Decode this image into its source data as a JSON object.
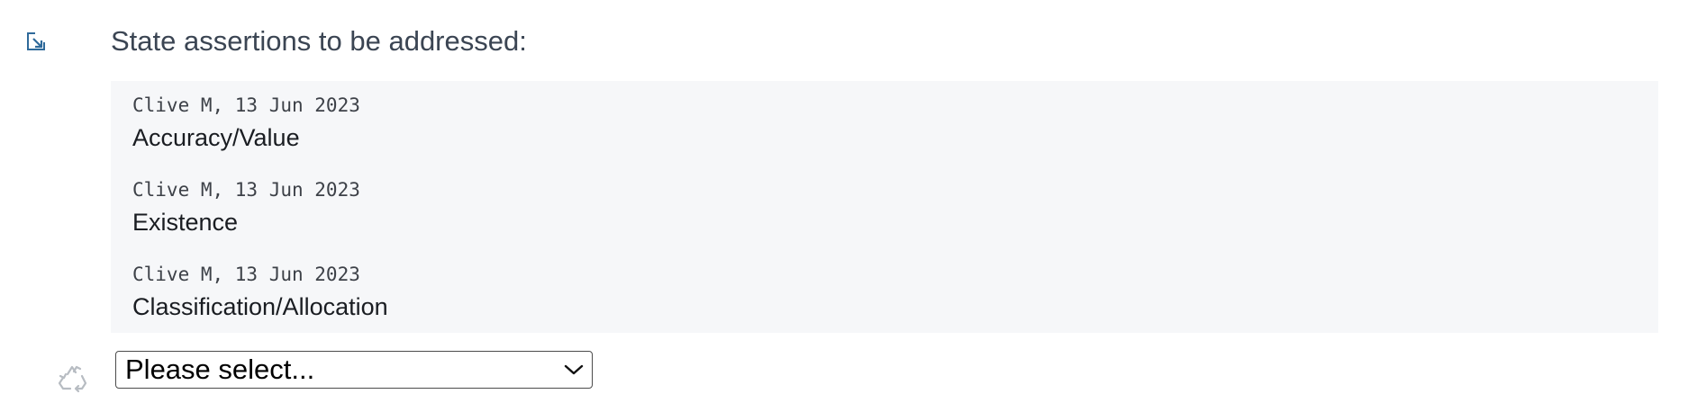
{
  "section": {
    "title": "State assertions to be addressed:",
    "link_icon": "open-link-icon"
  },
  "history": {
    "entries": [
      {
        "author_date": "Clive M, 13 Jun 2023",
        "value": "Accuracy/Value"
      },
      {
        "author_date": "Clive M, 13 Jun 2023",
        "value": "Existence"
      },
      {
        "author_date": "Clive M, 13 Jun 2023",
        "value": "Classification/Allocation"
      }
    ]
  },
  "select": {
    "selected": "Please select...",
    "icon": "chevron-down-icon"
  },
  "recycle": {
    "icon": "recycle-icon"
  },
  "colors": {
    "link_icon": "#2f6a9a",
    "panel_bg": "#f6f7f9",
    "heading": "#3b4553",
    "recycle_icon": "#b7bcc2"
  }
}
